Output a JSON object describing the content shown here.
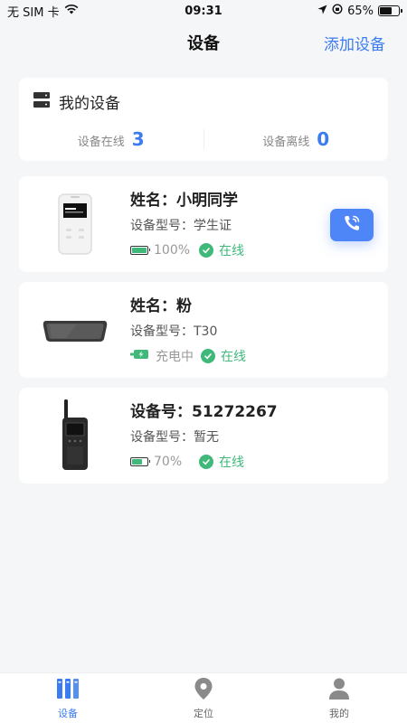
{
  "status_bar": {
    "carrier": "无 SIM 卡",
    "time": "09:31",
    "battery_text": "65%",
    "battery_level": 0.65
  },
  "nav": {
    "title": "设备",
    "action": "添加设备"
  },
  "summary": {
    "title": "我的设备",
    "online_label": "设备在线",
    "online_count": "3",
    "offline_label": "设备离线",
    "offline_count": "0"
  },
  "devices": [
    {
      "name": "姓名：小明同学",
      "model": "设备型号：学生证",
      "battery": "100%",
      "battery_level": 1.0,
      "status": "在线",
      "has_call": true
    },
    {
      "name": "姓名：粉",
      "model": "设备型号：T30",
      "battery": "充电中",
      "charging": true,
      "status": "在线"
    },
    {
      "name": "设备号：51272267",
      "model": "设备型号：暂无",
      "battery": "70%",
      "battery_level": 0.7,
      "status": "在线"
    }
  ],
  "colors": {
    "accent": "#3b7cf0",
    "online": "#3fb87a"
  },
  "tabs": [
    {
      "label": "设备",
      "icon": "devices-icon",
      "active": true
    },
    {
      "label": "定位",
      "icon": "location-pin-icon"
    },
    {
      "label": "我的",
      "icon": "person-icon"
    }
  ]
}
